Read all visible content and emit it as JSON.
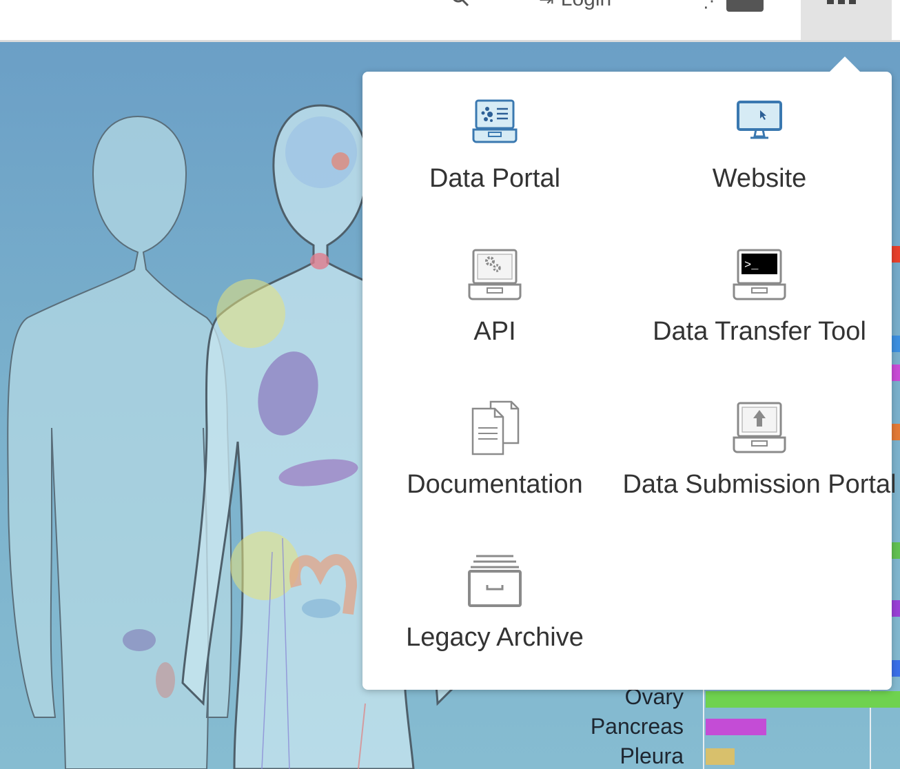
{
  "header": {
    "login_label": "Login",
    "search_icon": "search-icon",
    "cart_icon": "cart-icon",
    "apps_icon": "apps-grid-icon"
  },
  "apps_menu": {
    "items": [
      {
        "label": "Data Portal",
        "icon": "laptop-data-icon"
      },
      {
        "label": "Website",
        "icon": "monitor-cursor-icon"
      },
      {
        "label": "API",
        "icon": "laptop-gears-icon"
      },
      {
        "label": "Data Transfer Tool",
        "icon": "laptop-terminal-icon"
      },
      {
        "label": "Documentation",
        "icon": "documents-icon"
      },
      {
        "label": "Data Submission Portal",
        "icon": "laptop-upload-icon"
      },
      {
        "label": "Legacy Archive",
        "icon": "archive-drawer-icon"
      }
    ]
  },
  "background": {
    "organ_labels": [
      "Ovary",
      "Pancreas",
      "Pleura"
    ],
    "bar_colors": [
      "#e8402b",
      "#3c8fe0",
      "#c94bd6",
      "#e37a36",
      "#62c152",
      "#9a3fd6",
      "#3a6fe8",
      "#6fd24f",
      "#c44cd6",
      "#d8c06c"
    ]
  },
  "colors": {
    "accent": "#4a90c8",
    "icon_gray": "#8a8a8a",
    "text": "#333333"
  }
}
